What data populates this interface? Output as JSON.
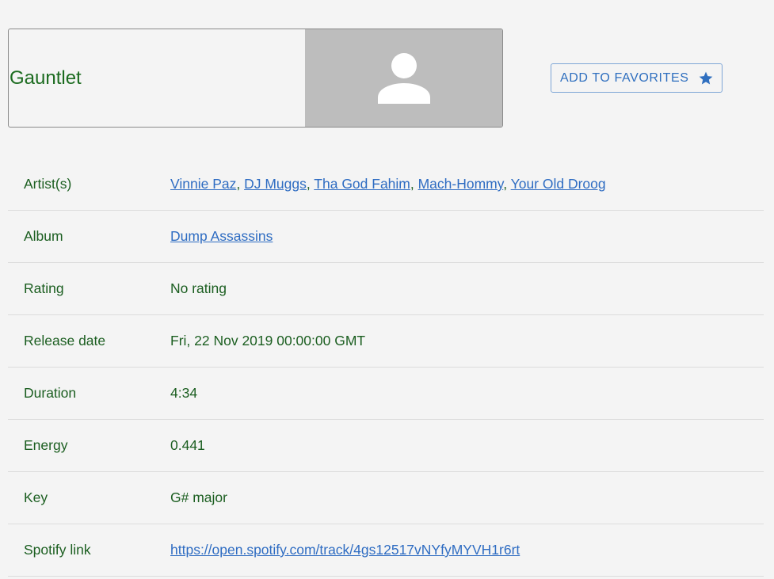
{
  "track": {
    "title": "Gauntlet"
  },
  "favorites": {
    "label": "ADD TO FAVORITES"
  },
  "details": {
    "artists_label": "Artist(s)",
    "artists": [
      "Vinnie Paz",
      "DJ Muggs",
      "Tha God Fahim",
      "Mach-Hommy",
      "Your Old Droog"
    ],
    "artist_separator": ", ",
    "album_label": "Album",
    "album": "Dump Assassins",
    "rating_label": "Rating",
    "rating": "No rating",
    "release_label": "Release date",
    "release": "Fri, 22 Nov 2019 00:00:00 GMT",
    "duration_label": "Duration",
    "duration": "4:34",
    "energy_label": "Energy",
    "energy": "0.441",
    "key_label": "Key",
    "key": "G# major",
    "spotify_label": "Spotify link",
    "spotify": "https://open.spotify.com/track/4gs12517vNYfyMYVH1r6rt"
  },
  "icons": {
    "avatar": "person-icon",
    "favorite": "star-icon"
  },
  "colors": {
    "text": "#1b5e20",
    "link": "#2e6cc2",
    "placeholder": "#bdbdbd"
  }
}
